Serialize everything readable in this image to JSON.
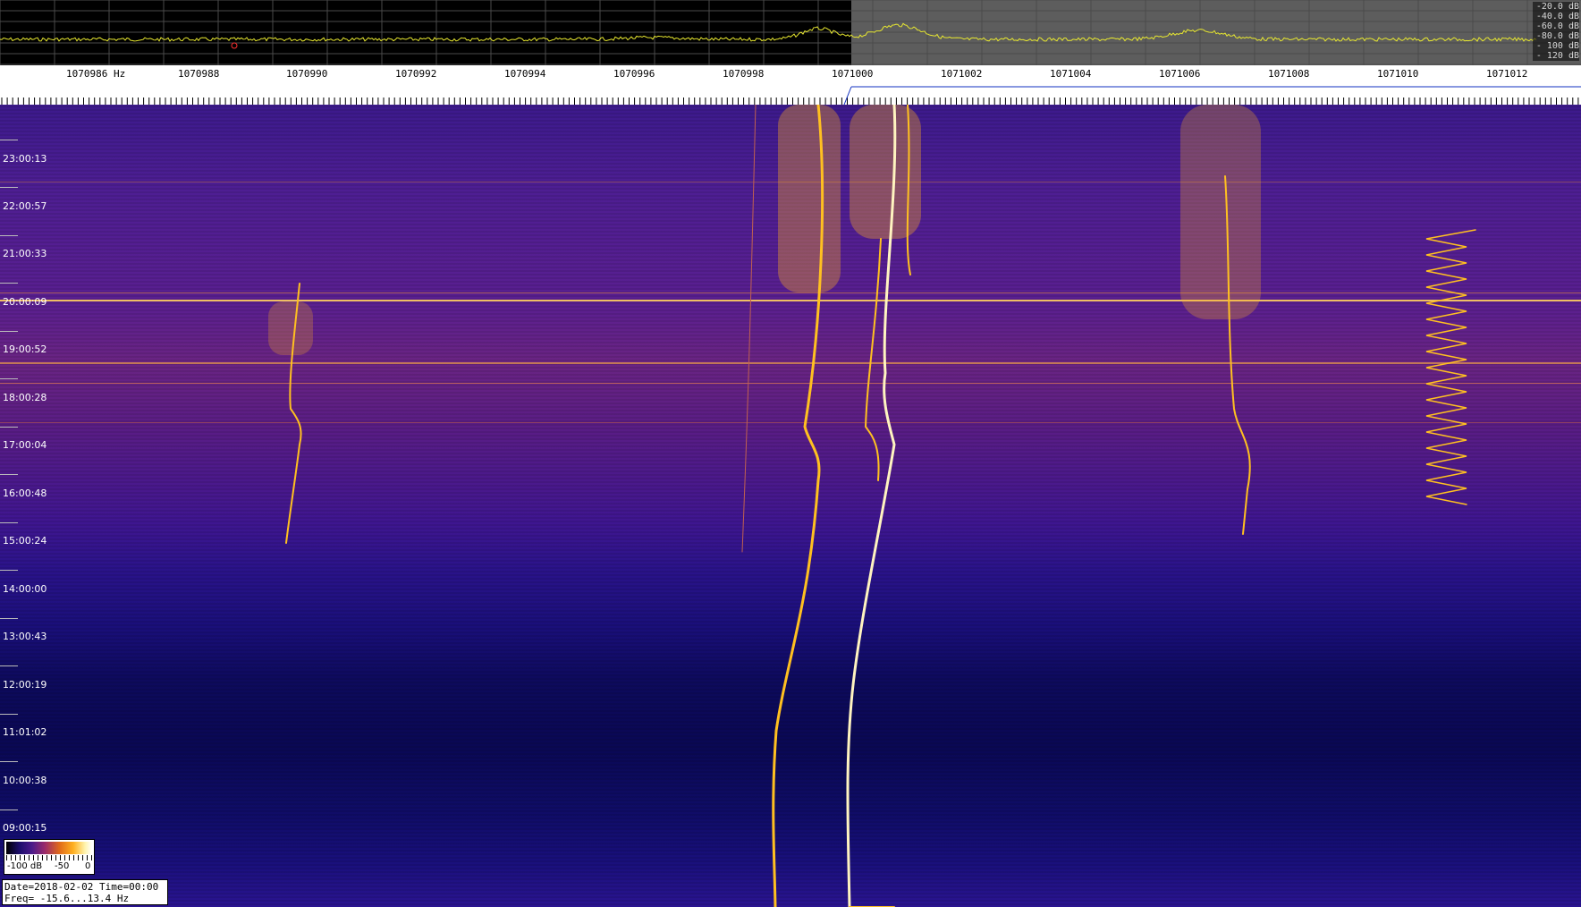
{
  "spectrum": {
    "db_scale": [
      "-20.0 dB",
      "-40.0 dB",
      "-60.0 dB",
      "-80.0 dB",
      "- 100 dB",
      "- 120 dB"
    ],
    "colors": {
      "trace": "#e8e830",
      "background": "#000000",
      "selected_band": "#5d5d5d",
      "marker": "#ff3030"
    }
  },
  "freq_axis": {
    "labels": [
      "1070986 Hz",
      "1070988",
      "1070990",
      "1070992",
      "1070994",
      "1070996",
      "1070998",
      "1071000",
      "1071002",
      "1071004",
      "1071006",
      "1071008",
      "1071010",
      "1071012"
    ]
  },
  "waterfall": {
    "time_labels": [
      "23:00:13",
      "22:00:57",
      "21:00:33",
      "20:00:09",
      "19:00:52",
      "18:00:28",
      "17:00:04",
      "16:00:48",
      "15:00:24",
      "14:00:00",
      "13:00:43",
      "12:00:19",
      "11:01:02",
      "10:00:38",
      "09:00:15"
    ],
    "colors": {
      "signal": "#ffc020",
      "signal_hot": "#fff4c0",
      "background_top": "#4d1e93",
      "background_bottom": "#0a0854"
    }
  },
  "legend": {
    "min": "-100 dB",
    "mid": "-50",
    "max": "0"
  },
  "info": {
    "line1": "Date=2018-02-02 Time=00:00",
    "line2": "Freq= -15.6...13.4 Hz"
  }
}
